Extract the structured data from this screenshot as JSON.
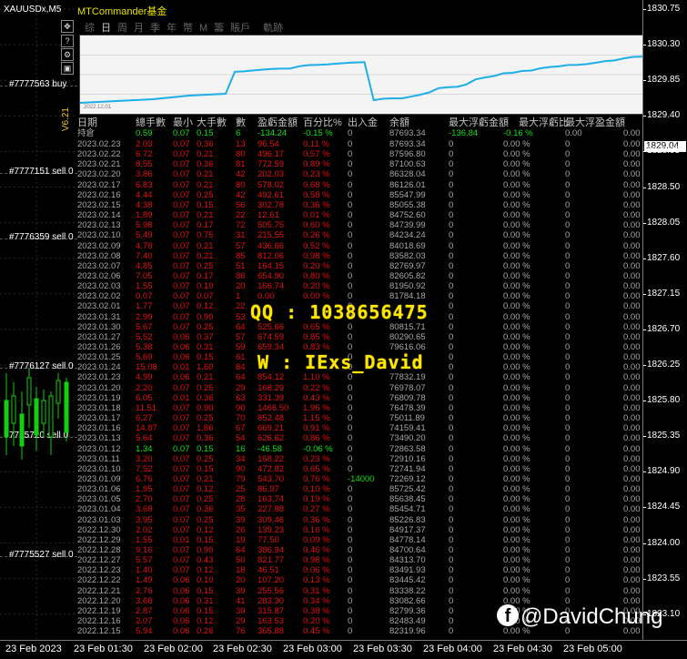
{
  "chart": {
    "symbol": "XAUUSDx,M5",
    "version": "V6.21",
    "orders": [
      {
        "label": "#7777563 buy"
      },
      {
        "label": "#7777151 sell 0"
      },
      {
        "label": "#7776359 sell 0"
      },
      {
        "label": "#7776127 sell 0"
      },
      {
        "label": "7775720 sell 0"
      },
      {
        "label": "#7775527 sell 0"
      }
    ],
    "price_labels": [
      "1830.75",
      "1830.30",
      "1829.85",
      "1829.40",
      "1828.95",
      "1828.50",
      "1828.05",
      "1827.60",
      "1827.15",
      "1826.70",
      "1826.25",
      "1825.80",
      "1825.35",
      "1824.90",
      "1824.45",
      "1824.00",
      "1823.55",
      "1823.10"
    ],
    "current_price": "1829.04",
    "time_labels": [
      "23 Feb 2023",
      "23 Feb 01:30",
      "23 Feb 02:00",
      "23 Feb 02:30",
      "23 Feb 03:00",
      "23 Feb 03:30",
      "23 Feb 04:00",
      "23 Feb 04:30",
      "23 Feb 05:00"
    ]
  },
  "panel": {
    "title": "MTCommander基金",
    "tabs": [
      "综",
      "日",
      "周",
      "月",
      "季",
      "年",
      "幣",
      "M",
      "籌",
      "賬戶",
      "",
      "軌跡"
    ],
    "curve_date": "2022.12.01",
    "headers": [
      "日期",
      "總手數",
      "最小",
      "大手數",
      "數",
      "盈虧金額",
      "百分比%",
      "出入金",
      "余額",
      "最大浮虧金額",
      "最大浮虧比",
      "最大浮盈金額"
    ],
    "summary": {
      "date": "持倉",
      "lots": "0.59",
      "min": "0.07",
      "max": "0.15",
      "count": "6",
      "pnl": "-134.24",
      "pct": "-0.15 %",
      "flow": "0",
      "balance": "87693.34",
      "maxloss": "-136.84",
      "maxlosspct": "-0.16 %",
      "maxgain": "0.00",
      "extra": "0.00"
    },
    "rows": [
      {
        "date": "2023.02.23",
        "lots": "2.03",
        "min": "0.07",
        "max": "0.36",
        "count": "13",
        "pnl": "96.54",
        "pct": "0.11 %",
        "flow": "0",
        "balance": "87693.34"
      },
      {
        "date": "2023.02.22",
        "lots": "6.72",
        "min": "0.07",
        "max": "0.21",
        "count": "80",
        "pnl": "496.17",
        "pct": "0.57 %",
        "flow": "0",
        "balance": "87596.80"
      },
      {
        "date": "2023.02.21",
        "lots": "8.55",
        "min": "0.07",
        "max": "0.36",
        "count": "81",
        "pnl": "772.59",
        "pct": "0.89 %",
        "flow": "0",
        "balance": "87100.63"
      },
      {
        "date": "2023.02.20",
        "lots": "3.86",
        "min": "0.07",
        "max": "0.21",
        "count": "42",
        "pnl": "202.03",
        "pct": "0.23 %",
        "flow": "0",
        "balance": "86328.04"
      },
      {
        "date": "2023.02.17",
        "lots": "6.83",
        "min": "0.07",
        "max": "0.21",
        "count": "80",
        "pnl": "578.02",
        "pct": "0.68 %",
        "flow": "0",
        "balance": "86126.01"
      },
      {
        "date": "2023.02.16",
        "lots": "4.44",
        "min": "0.07",
        "max": "0.25",
        "count": "42",
        "pnl": "492.61",
        "pct": "0.58 %",
        "flow": "0",
        "balance": "85547.99"
      },
      {
        "date": "2023.02.15",
        "lots": "4.38",
        "min": "0.07",
        "max": "0.15",
        "count": "56",
        "pnl": "302.78",
        "pct": "0.36 %",
        "flow": "0",
        "balance": "85055.38"
      },
      {
        "date": "2023.02.14",
        "lots": "1.89",
        "min": "0.07",
        "max": "0.21",
        "count": "22",
        "pnl": "12.61",
        "pct": "0.01 %",
        "flow": "0",
        "balance": "84752.60"
      },
      {
        "date": "2023.02.13",
        "lots": "5.98",
        "min": "0.07",
        "max": "0.17",
        "count": "72",
        "pnl": "505.75",
        "pct": "0.60 %",
        "flow": "0",
        "balance": "84739.99"
      },
      {
        "date": "2023.02.10",
        "lots": "5.49",
        "min": "0.07",
        "max": "0.75",
        "count": "31",
        "pnl": "215.55",
        "pct": "0.26 %",
        "flow": "0",
        "balance": "84234.24"
      },
      {
        "date": "2023.02.09",
        "lots": "4.78",
        "min": "0.07",
        "max": "0.21",
        "count": "57",
        "pnl": "436.66",
        "pct": "0.52 %",
        "flow": "0",
        "balance": "84018.69"
      },
      {
        "date": "2023.02.08",
        "lots": "7.40",
        "min": "0.07",
        "max": "0.21",
        "count": "85",
        "pnl": "812.06",
        "pct": "0.98 %",
        "flow": "0",
        "balance": "83582.03"
      },
      {
        "date": "2023.02.07",
        "lots": "4.85",
        "min": "0.07",
        "max": "0.25",
        "count": "51",
        "pnl": "164.15",
        "pct": "0.20 %",
        "flow": "0",
        "balance": "82769.97"
      },
      {
        "date": "2023.02.06",
        "lots": "7.05",
        "min": "0.07",
        "max": "0.17",
        "count": "86",
        "pnl": "654.90",
        "pct": "0.80 %",
        "flow": "0",
        "balance": "82605.82"
      },
      {
        "date": "2023.02.03",
        "lots": "1.55",
        "min": "0.07",
        "max": "0.10",
        "count": "20",
        "pnl": "166.74",
        "pct": "0.20 %",
        "flow": "0",
        "balance": "81950.92"
      },
      {
        "date": "2023.02.02",
        "lots": "0.07",
        "min": "0.07",
        "max": "0.07",
        "count": "1",
        "pnl": "0.00",
        "pct": "0.00 %",
        "flow": "0",
        "balance": "81784.18"
      },
      {
        "date": "2023.02.01",
        "lots": "1.77",
        "min": "0.07",
        "max": "0.12",
        "count": "22",
        "pnl": "",
        "pct": "",
        "flow": "0",
        "balance": ""
      },
      {
        "date": "2023.01.31",
        "lots": "2.99",
        "min": "0.07",
        "max": "0.90",
        "count": "53",
        "pnl": "",
        "pct": "",
        "flow": "0",
        "balance": ""
      },
      {
        "date": "2023.01.30",
        "lots": "5.67",
        "min": "0.07",
        "max": "0.25",
        "count": "64",
        "pnl": "525.66",
        "pct": "0.65 %",
        "flow": "0",
        "balance": "80815.71"
      },
      {
        "date": "2023.01.27",
        "lots": "5.52",
        "min": "0.06",
        "max": "0.37",
        "count": "57",
        "pnl": "674.59",
        "pct": "0.85 %",
        "flow": "0",
        "balance": "80290.65"
      },
      {
        "date": "2023.01.26",
        "lots": "5.38",
        "min": "0.06",
        "max": "0.31",
        "count": "59",
        "pnl": "659.34",
        "pct": "0.83 %",
        "flow": "0",
        "balance": "79616.06"
      },
      {
        "date": "2023.01.25",
        "lots": "5.69",
        "min": "0.06",
        "max": "0.15",
        "count": "61",
        "pnl": "",
        "pct": "",
        "flow": "0",
        "balance": ""
      },
      {
        "date": "2023.01.24",
        "lots": "15.08",
        "min": "0.01",
        "max": "1.60",
        "count": "84",
        "pnl": "",
        "pct": "",
        "flow": "0",
        "balance": ""
      },
      {
        "date": "2023.01.23",
        "lots": "4.99",
        "min": "0.06",
        "max": "0.21",
        "count": "64",
        "pnl": "854.12",
        "pct": "1.10 %",
        "flow": "0",
        "balance": "77832.19"
      },
      {
        "date": "2023.01.20",
        "lots": "2.20",
        "min": "0.07",
        "max": "0.25",
        "count": "29",
        "pnl": "168.29",
        "pct": "0.22 %",
        "flow": "0",
        "balance": "76978.07"
      },
      {
        "date": "2023.01.19",
        "lots": "6.05",
        "min": "0.01",
        "max": "0.36",
        "count": "63",
        "pnl": "331.39",
        "pct": "0.43 %",
        "flow": "0",
        "balance": "76809.78"
      },
      {
        "date": "2023.01.18",
        "lots": "11.51",
        "min": "0.07",
        "max": "0.90",
        "count": "90",
        "pnl": "1466.50",
        "pct": "1.96 %",
        "flow": "0",
        "balance": "76478.39"
      },
      {
        "date": "2023.01.17",
        "lots": "6.27",
        "min": "0.07",
        "max": "0.25",
        "count": "70",
        "pnl": "852.48",
        "pct": "1.15 %",
        "flow": "0",
        "balance": "75011.89"
      },
      {
        "date": "2023.01.16",
        "lots": "14.87",
        "min": "0.07",
        "max": "1.86",
        "count": "67",
        "pnl": "669.21",
        "pct": "0.91 %",
        "flow": "0",
        "balance": "74159.41"
      },
      {
        "date": "2023.01.13",
        "lots": "5.64",
        "min": "0.07",
        "max": "0.36",
        "count": "54",
        "pnl": "626.62",
        "pct": "0.86 %",
        "flow": "0",
        "balance": "73490.20"
      },
      {
        "date": "2023.01.12",
        "lots": "1.34",
        "min": "0.07",
        "max": "0.15",
        "count": "16",
        "pnl": "-46.58",
        "pct": "-0.06 %",
        "flow": "0",
        "balance": "72863.58",
        "neg": true
      },
      {
        "date": "2023.01.11",
        "lots": "3.20",
        "min": "0.07",
        "max": "0.25",
        "count": "34",
        "pnl": "168.22",
        "pct": "0.23 %",
        "flow": "0",
        "balance": "72910.16"
      },
      {
        "date": "2023.01.10",
        "lots": "7.52",
        "min": "0.07",
        "max": "0.15",
        "count": "90",
        "pnl": "472.82",
        "pct": "0.65 %",
        "flow": "0",
        "balance": "72741.94"
      },
      {
        "date": "2023.01.09",
        "lots": "6.76",
        "min": "0.07",
        "max": "0.21",
        "count": "79",
        "pnl": "543.70",
        "pct": "0.76 %",
        "flow": "-14000",
        "balance": "72269.12"
      },
      {
        "date": "2023.01.06",
        "lots": "1.95",
        "min": "0.07",
        "max": "0.12",
        "count": "25",
        "pnl": "86.97",
        "pct": "0.10 %",
        "flow": "0",
        "balance": "85725.42"
      },
      {
        "date": "2023.01.05",
        "lots": "2.70",
        "min": "0.07",
        "max": "0.25",
        "count": "28",
        "pnl": "163.74",
        "pct": "0.19 %",
        "flow": "0",
        "balance": "85638.45"
      },
      {
        "date": "2023.01.04",
        "lots": "3.68",
        "min": "0.07",
        "max": "0.36",
        "count": "35",
        "pnl": "227.88",
        "pct": "0.27 %",
        "flow": "0",
        "balance": "85454.71"
      },
      {
        "date": "2023.01.03",
        "lots": "3.95",
        "min": "0.07",
        "max": "0.25",
        "count": "39",
        "pnl": "309.46",
        "pct": "0.36 %",
        "flow": "0",
        "balance": "85226.83"
      },
      {
        "date": "2022.12.30",
        "lots": "2.02",
        "min": "0.07",
        "max": "0.12",
        "count": "26",
        "pnl": "139.23",
        "pct": "0.16 %",
        "flow": "0",
        "balance": "84917.37"
      },
      {
        "date": "2022.12.29",
        "lots": "1.55",
        "min": "0.01",
        "max": "0.15",
        "count": "19",
        "pnl": "77.50",
        "pct": "0.09 %",
        "flow": "0",
        "balance": "84778.14"
      },
      {
        "date": "2022.12.28",
        "lots": "9.16",
        "min": "0.07",
        "max": "0.90",
        "count": "64",
        "pnl": "386.94",
        "pct": "0.46 %",
        "flow": "0",
        "balance": "84700.64"
      },
      {
        "date": "2022.12.27",
        "lots": "5.57",
        "min": "0.07",
        "max": "0.43",
        "count": "50",
        "pnl": "821.77",
        "pct": "0.98 %",
        "flow": "0",
        "balance": "84313.70"
      },
      {
        "date": "2022.12.23",
        "lots": "1.40",
        "min": "0.07",
        "max": "0.12",
        "count": "18",
        "pnl": "46.51",
        "pct": "0.06 %",
        "flow": "0",
        "balance": "83491.93"
      },
      {
        "date": "2022.12.22",
        "lots": "1.49",
        "min": "0.06",
        "max": "0.10",
        "count": "20",
        "pnl": "107.20",
        "pct": "0.13 %",
        "flow": "0",
        "balance": "83445.42"
      },
      {
        "date": "2022.12.21",
        "lots": "2.76",
        "min": "0.06",
        "max": "0.15",
        "count": "39",
        "pnl": "255.56",
        "pct": "0.31 %",
        "flow": "0",
        "balance": "83338.22"
      },
      {
        "date": "2022.12.20",
        "lots": "3.68",
        "min": "0.06",
        "max": "0.31",
        "count": "41",
        "pnl": "283.30",
        "pct": "0.34 %",
        "flow": "0",
        "balance": "83082.66"
      },
      {
        "date": "2022.12.19",
        "lots": "2.87",
        "min": "0.06",
        "max": "0.15",
        "count": "39",
        "pnl": "315.87",
        "pct": "0.38 %",
        "flow": "0",
        "balance": "82799.36"
      },
      {
        "date": "2022.12.16",
        "lots": "2.07",
        "min": "0.06",
        "max": "0.12",
        "count": "29",
        "pnl": "163.53",
        "pct": "0.20 %",
        "flow": "0",
        "balance": "82483.49"
      },
      {
        "date": "2022.12.15",
        "lots": "5.94",
        "min": "0.06",
        "max": "0.26",
        "count": "76",
        "pnl": "365.88",
        "pct": "0.45 %",
        "flow": "0",
        "balance": "82319.96"
      }
    ],
    "row_tail": {
      "maxloss": "0",
      "maxlosspct": "0.00 %",
      "maxgain": "0",
      "extra": "0.00"
    }
  },
  "overlay": {
    "qq": "QQ : 1038656475",
    "wechat": "W : IExs_David",
    "brand": "@DavidChung"
  },
  "colors": {
    "profit": "#e31010",
    "loss": "#10e010",
    "curve": "#1eaee8",
    "title": "#e8e000"
  }
}
